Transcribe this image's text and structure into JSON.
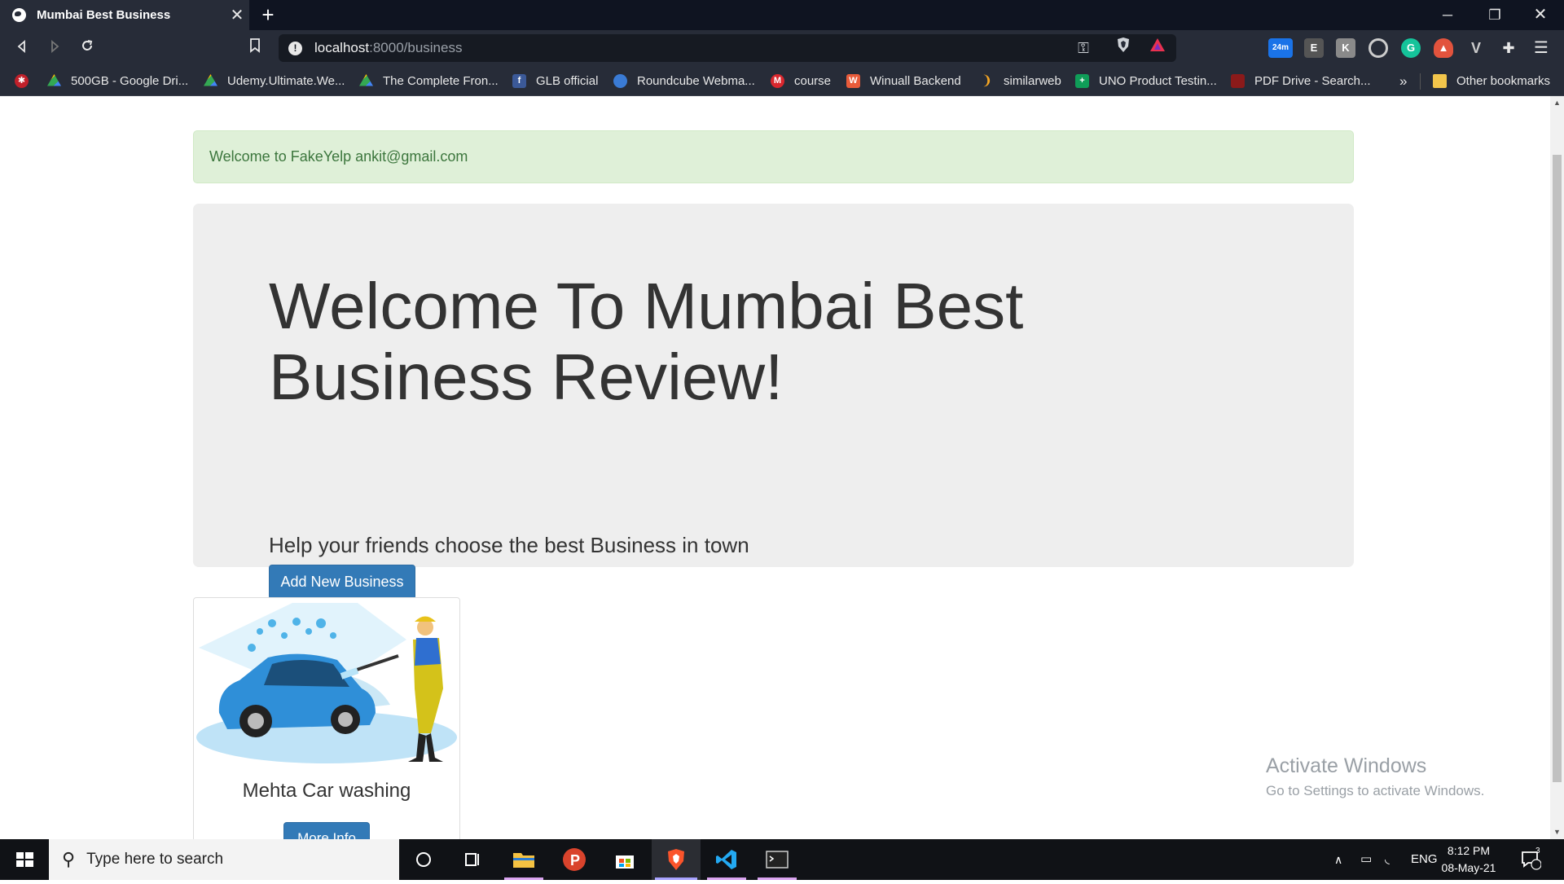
{
  "browser": {
    "tab_title": "Mumbai Best Business",
    "tab_close": "✕",
    "new_tab": "+",
    "url_host": "localhost",
    "url_path": ":8000/business",
    "extension_badge": "24m",
    "bookmarks": [
      {
        "label": "500GB - Google Dri...",
        "icon": "google-drive-icon"
      },
      {
        "label": "Udemy.Ultimate.We...",
        "icon": "google-drive-icon"
      },
      {
        "label": "The Complete Fron...",
        "icon": "google-drive-icon"
      },
      {
        "label": "GLB official",
        "icon": "facebook-icon"
      },
      {
        "label": "Roundcube Webma...",
        "icon": "roundcube-icon"
      },
      {
        "label": "course",
        "icon": "mega-icon"
      },
      {
        "label": "Winuall Backend",
        "icon": "winuall-icon"
      },
      {
        "label": "similarweb",
        "icon": "similarweb-icon"
      },
      {
        "label": "UNO Product Testin...",
        "icon": "sheets-icon"
      },
      {
        "label": "PDF Drive - Search...",
        "icon": "pdf-drive-icon"
      }
    ],
    "bookmarks_overflow": "»",
    "other_bookmarks": "Other bookmarks"
  },
  "page": {
    "alert_text": "Welcome to FakeYelp ankit@gmail.com",
    "jumbotron_title": "Welcome To Mumbai Best Business Review!",
    "jumbotron_lead": "Help your friends choose the best Business in town",
    "add_button": "Add New Business",
    "cards": [
      {
        "title": "Mehta Car washing",
        "button": "More Info",
        "image": "car-wash-illustration"
      }
    ]
  },
  "watermark": {
    "line1": "Activate Windows",
    "line2": "Go to Settings to activate Windows."
  },
  "taskbar": {
    "search_placeholder": "Type here to search",
    "language": "ENG",
    "time": "8:12 PM",
    "date": "08-May-21",
    "notification_count": "3"
  },
  "colors": {
    "primary": "#337ab7",
    "alert_bg": "#dff0d8",
    "alert_text": "#3c763d",
    "jumbotron_bg": "#eeeeee",
    "chrome_dark": "#272c38"
  }
}
